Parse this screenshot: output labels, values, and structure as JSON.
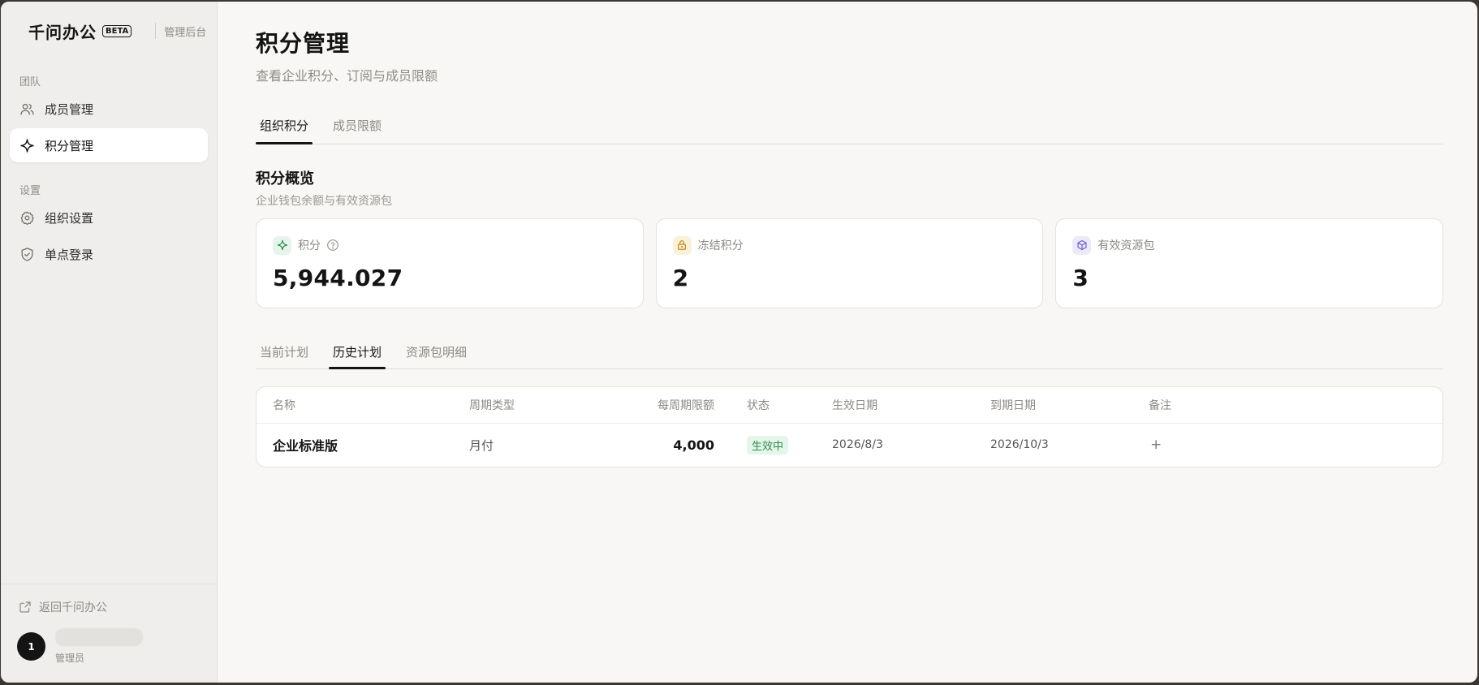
{
  "brand": {
    "name": "千问办公",
    "beta": "BETA",
    "admin_label": "管理后台"
  },
  "sidebar": {
    "groups": [
      {
        "label": "团队",
        "items": [
          {
            "label": "成员管理",
            "icon": "users-icon"
          },
          {
            "label": "积分管理",
            "icon": "sparkle-icon",
            "active": true
          }
        ]
      },
      {
        "label": "设置",
        "items": [
          {
            "label": "组织设置",
            "icon": "gear-icon"
          },
          {
            "label": "单点登录",
            "icon": "shield-icon"
          }
        ]
      }
    ],
    "back_link": "返回千问办公",
    "user": {
      "avatar_text": "1",
      "role": "管理员"
    }
  },
  "page": {
    "title": "积分管理",
    "subtitle": "查看企业积分、订阅与成员限额"
  },
  "top_tabs": [
    {
      "label": "组织积分",
      "active": true
    },
    {
      "label": "成员限额"
    }
  ],
  "overview": {
    "title": "积分概览",
    "desc": "企业钱包余额与有效资源包",
    "cards": [
      {
        "label": "积分",
        "value": "5,944.027",
        "icon": "sparkle-icon",
        "color": "#2e8b4f"
      },
      {
        "label": "冻结积分",
        "value": "2",
        "icon": "lock-icon",
        "color": "#c98a1a"
      },
      {
        "label": "有效资源包",
        "value": "3",
        "icon": "box-icon",
        "color": "#6b5bd1"
      }
    ]
  },
  "sub_tabs": [
    {
      "label": "当前计划"
    },
    {
      "label": "历史计划",
      "active": true
    },
    {
      "label": "资源包明细"
    }
  ],
  "table": {
    "columns": {
      "name": "名称",
      "cycle": "周期类型",
      "limit": "每周期限额",
      "status": "状态",
      "start": "生效日期",
      "end": "到期日期",
      "note": "备注"
    },
    "rows": [
      {
        "name": "企业标准版",
        "cycle": "月付",
        "limit": "4,000",
        "status": "生效中",
        "start": "2026/8/3",
        "end": "2026/10/3",
        "note": "+"
      }
    ]
  }
}
